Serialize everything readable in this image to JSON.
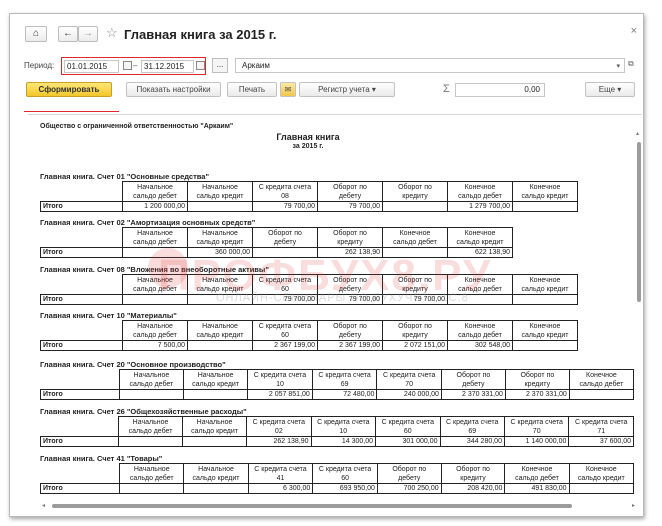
{
  "window": {
    "title": "Главная книга за 2015 г.",
    "home_icon": "⌂",
    "back_icon": "←",
    "forward_icon": "→",
    "star_icon": "☆",
    "close_icon": "×"
  },
  "period": {
    "label": "Период:",
    "from": "01.01.2015",
    "to": "31.12.2015",
    "dash": "–",
    "more": "...",
    "organization": "Аркаим",
    "dropdown_icon": "▾",
    "open_icon": "⧉"
  },
  "toolbar": {
    "generate": "Сформировать",
    "settings": "Показать настройки",
    "print": "Печать",
    "mail_icon": "✉",
    "register": "Регистр учета",
    "register_arrow": "▾",
    "sigma": "Σ",
    "sum_value": "0,00",
    "more": "Еще",
    "more_arrow": "▾"
  },
  "report": {
    "org_name": "Общество с ограниченной ответственностью \"Аркаим\"",
    "title": "Главная книга",
    "period": "за 2015 г.",
    "sections": [
      {
        "title": "Главная книга. Счет 01 \"Основные средства\"",
        "headers": [
          "Начальное\nсальдо дебет",
          "Начальное\nсальдо кредит",
          "С кредита счета\n08",
          "Оборот по\nдебету",
          "Оборот по\nкредиту",
          "Конечное\nсальдо дебет",
          "Конечное\nсальдо кредит"
        ],
        "total_label": "Итого",
        "values": [
          "1 200 000,00",
          "",
          "79 700,00",
          "79 700,00",
          "",
          "1 279 700,00",
          ""
        ]
      },
      {
        "title": "Главная книга. Счет 02 \"Амортизация основных средств\"",
        "headers": [
          "Начальное\nсальдо дебет",
          "Начальное\nсальдо кредит",
          "Оборот по\nдебету",
          "Оборот по\nкредиту",
          "Конечное\nсальдо дебет",
          "Конечное\nсальдо кредит"
        ],
        "total_label": "Итого",
        "values": [
          "",
          "360 000,00",
          "",
          "262 138,90",
          "",
          "622 138,90"
        ]
      },
      {
        "title": "Главная книга. Счет 08 \"Вложения во внеоборотные активы\"",
        "headers": [
          "Начальное\nсальдо дебет",
          "Начальное\nсальдо кредит",
          "С кредита счета\n60",
          "Оборот по\nдебету",
          "Оборот по\nкредиту",
          "Конечное\nсальдо дебет",
          "Конечное\nсальдо кредит"
        ],
        "total_label": "Итого",
        "values": [
          "",
          "",
          "79 700,00",
          "79 700,00",
          "79 700,00",
          "",
          ""
        ]
      },
      {
        "title": "Главная книга. Счет 10 \"Материалы\"",
        "headers": [
          "Начальное\nсальдо дебет",
          "Начальное\nсальдо кредит",
          "С кредита счета\n60",
          "Оборот по\nдебету",
          "Оборот по\nкредиту",
          "Конечное\nсальдо дебет",
          "Конечное\nсальдо кредит"
        ],
        "total_label": "Итого",
        "values": [
          "7 500,00",
          "",
          "2 367 199,00",
          "2 367 199,00",
          "2 072 151,00",
          "302 548,00",
          ""
        ]
      },
      {
        "title": "Главная книга. Счет 20 \"Основное производство\"",
        "headers": [
          "Начальное\nсальдо дебет",
          "Начальное\nсальдо кредит",
          "С кредита счета\n10",
          "С кредита счета\n69",
          "С кредита счета\n70",
          "Оборот по\nдебету",
          "Оборот по\nкредиту",
          "Конечное\nсальдо дебет"
        ],
        "total_label": "Итого",
        "values": [
          "",
          "",
          "2 057 851,00",
          "72 480,00",
          "240 000,00",
          "2 370 331,00",
          "2 370 331,00",
          ""
        ]
      },
      {
        "title": "Главная книга. Счет 26 \"Общехозяйственные расходы\"",
        "headers": [
          "Начальное\nсальдо дебет",
          "Начальное\nсальдо кредит",
          "С кредита счета\n02",
          "С кредита счета\n10",
          "С кредита счета\n60",
          "С кредита счета\n69",
          "С кредита счета\n70",
          "С кредита счета\n71"
        ],
        "total_label": "Итого",
        "values": [
          "",
          "",
          "262 138,90",
          "14 300,00",
          "301 000,00",
          "344 280,00",
          "1 140 000,00",
          "37 600,00"
        ]
      },
      {
        "title": "Главная книга. Счет 41 \"Товары\"",
        "headers": [
          "Начальное\nсальдо дебет",
          "Начальное\nсальдо кредит",
          "С кредита счета\n41",
          "С кредита счета\n60",
          "Оборот по\nдебету",
          "Оборот по\nкредиту",
          "Конечное\nсальдо дебет",
          "Конечное\nсальдо кредит"
        ],
        "total_label": "Итого",
        "values": [
          "",
          "",
          "6 300,00",
          "693 950,00",
          "700 250,00",
          "208 420,00",
          "491 830,00",
          ""
        ]
      }
    ]
  },
  "watermark": {
    "main": "ПРОФБУХ8.РУ",
    "sub": "ОНЛАЙН-СЕМИНАРЫ ПО БУХУЧЕТУ 1С:8"
  },
  "colors": {
    "accent_yellow": "#f3c72b",
    "highlight_red": "#e1262d"
  }
}
